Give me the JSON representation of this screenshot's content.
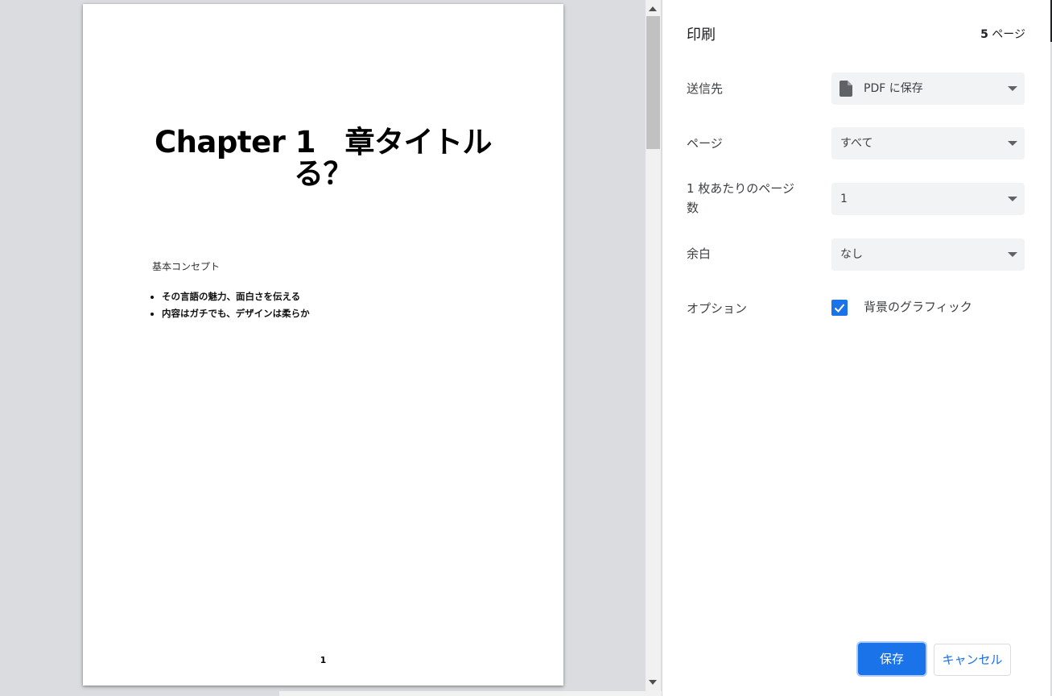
{
  "preview": {
    "title_line1": "Chapter 1　章タイトル",
    "title_line2": "る？",
    "section_heading": "基本コンセプト",
    "bullets": [
      "その言語の魅力、面白さを伝える",
      "内容はガチでも、デザインは柔らか"
    ],
    "page_number": "1"
  },
  "settings": {
    "title": "印刷",
    "page_count_number": "5",
    "page_count_unit": " ページ",
    "destination": {
      "label": "送信先",
      "value": "PDF に保存",
      "icon": "file-icon"
    },
    "pages": {
      "label": "ページ",
      "value": "すべて"
    },
    "pages_per_sheet": {
      "label_line1": "1 枚あたりのページ",
      "label_line2": "数",
      "value": "1"
    },
    "margins": {
      "label": "余白",
      "value": "なし"
    },
    "options": {
      "label": "オプション",
      "checkbox_label": "背景のグラフィック",
      "checked": true
    }
  },
  "buttons": {
    "save": "保存",
    "cancel": "キャンセル"
  },
  "colors": {
    "accent": "#1a73e8",
    "background": "#dadce0"
  }
}
